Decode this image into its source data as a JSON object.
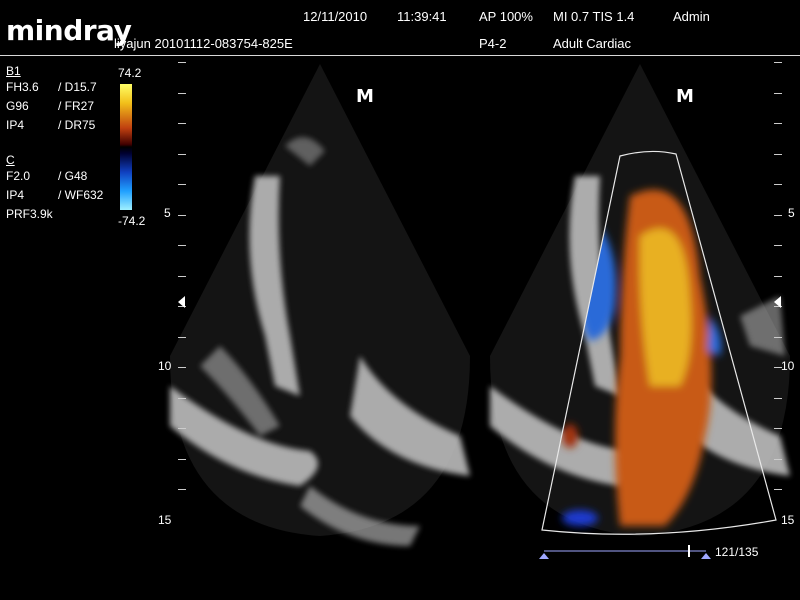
{
  "header": {
    "logo": "mindray",
    "date": "12/11/2010",
    "time": "11:39:41",
    "ap": "AP  100%",
    "mi_tis": "MI 0.7  TIS 1.4",
    "user": "Admin",
    "patient_id": "liyajun 20101112-083754-825E",
    "probe": "P4-2",
    "exam": "Adult Cardiac"
  },
  "params": {
    "b_section": "B1",
    "b_rows": [
      [
        "FH3.6",
        "/ D15.7"
      ],
      [
        "G96",
        "/ FR27"
      ],
      [
        "IP4",
        "/ DR75"
      ]
    ],
    "c_section": "C",
    "c_rows": [
      [
        "F2.0",
        "/ G48"
      ],
      [
        "IP4",
        "/ WF632"
      ],
      [
        "PRF3.9k",
        ""
      ]
    ]
  },
  "color_scale": {
    "max": "74.2",
    "min": "-74.2"
  },
  "depth_labels": [
    "5",
    "10",
    "15"
  ],
  "marker": "M",
  "cine": {
    "frame": "121/135"
  },
  "colors": {
    "background": "#000000",
    "text": "#ffffff",
    "cine_bar": "#a0a8ff"
  }
}
